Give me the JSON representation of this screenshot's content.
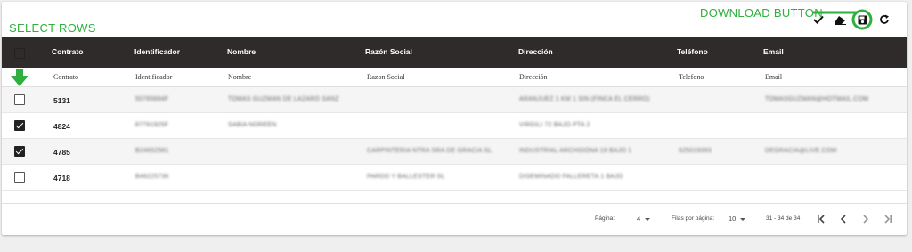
{
  "annotations": {
    "select_rows": "SELECT ROWS",
    "download_button": "DOWNLOAD BUTTON",
    "accent_color": "#2eaf3e"
  },
  "toolbar": {
    "icons": [
      "check-icon",
      "eraser-icon",
      "save-icon",
      "refresh-icon"
    ]
  },
  "table": {
    "headers": [
      "Contrato",
      "Identificador",
      "Nombre",
      "Razón Social",
      "Dirección",
      "Teléfono",
      "Email"
    ],
    "filters": [
      "Contrato",
      "Identificador",
      "Nombre",
      "Razon Social",
      "Dirección",
      "Telefono",
      "Email"
    ],
    "header_bg": "#2f2b2b",
    "rows": [
      {
        "checked": false,
        "contrato": "5131",
        "identificador": "50765694F",
        "nombre": "TOMAS GUZMAN DE LAZARO SANZ",
        "razon_social": "",
        "direccion": "ARANJUEZ 1 KM 1 SIN (FINCA EL CERRO)",
        "telefono": "",
        "email": "TOMASGUZMAN@HOTMAIL.COM"
      },
      {
        "checked": true,
        "contrato": "4824",
        "identificador": "87791925F",
        "nombre": "SABIA NOREEN",
        "razon_social": "",
        "direccion": "VIRGILI 72 BAJO PTA 2",
        "telefono": "",
        "email": ""
      },
      {
        "checked": true,
        "contrato": "4785",
        "identificador": "B24652581",
        "nombre": "",
        "razon_social": "CARPINTERIA NTRA SRA DE GRACIA SL",
        "direccion": "INDUSTRIAL ARCHIDONA 19 BAJO 1",
        "telefono": "625019393",
        "email": "DEGRACIA@LIVE.COM"
      },
      {
        "checked": false,
        "contrato": "4718",
        "identificador": "B46225736",
        "nombre": "",
        "razon_social": "PARDO Y BALLESTER SL",
        "direccion": "DISEMINADO FALLERETA 1 BAJO",
        "telefono": "",
        "email": ""
      }
    ]
  },
  "pagination": {
    "page_label": "Página:",
    "page_value": "4",
    "rows_label": "Filas por página:",
    "rows_value": "10",
    "range": "31 - 34 de 34"
  }
}
